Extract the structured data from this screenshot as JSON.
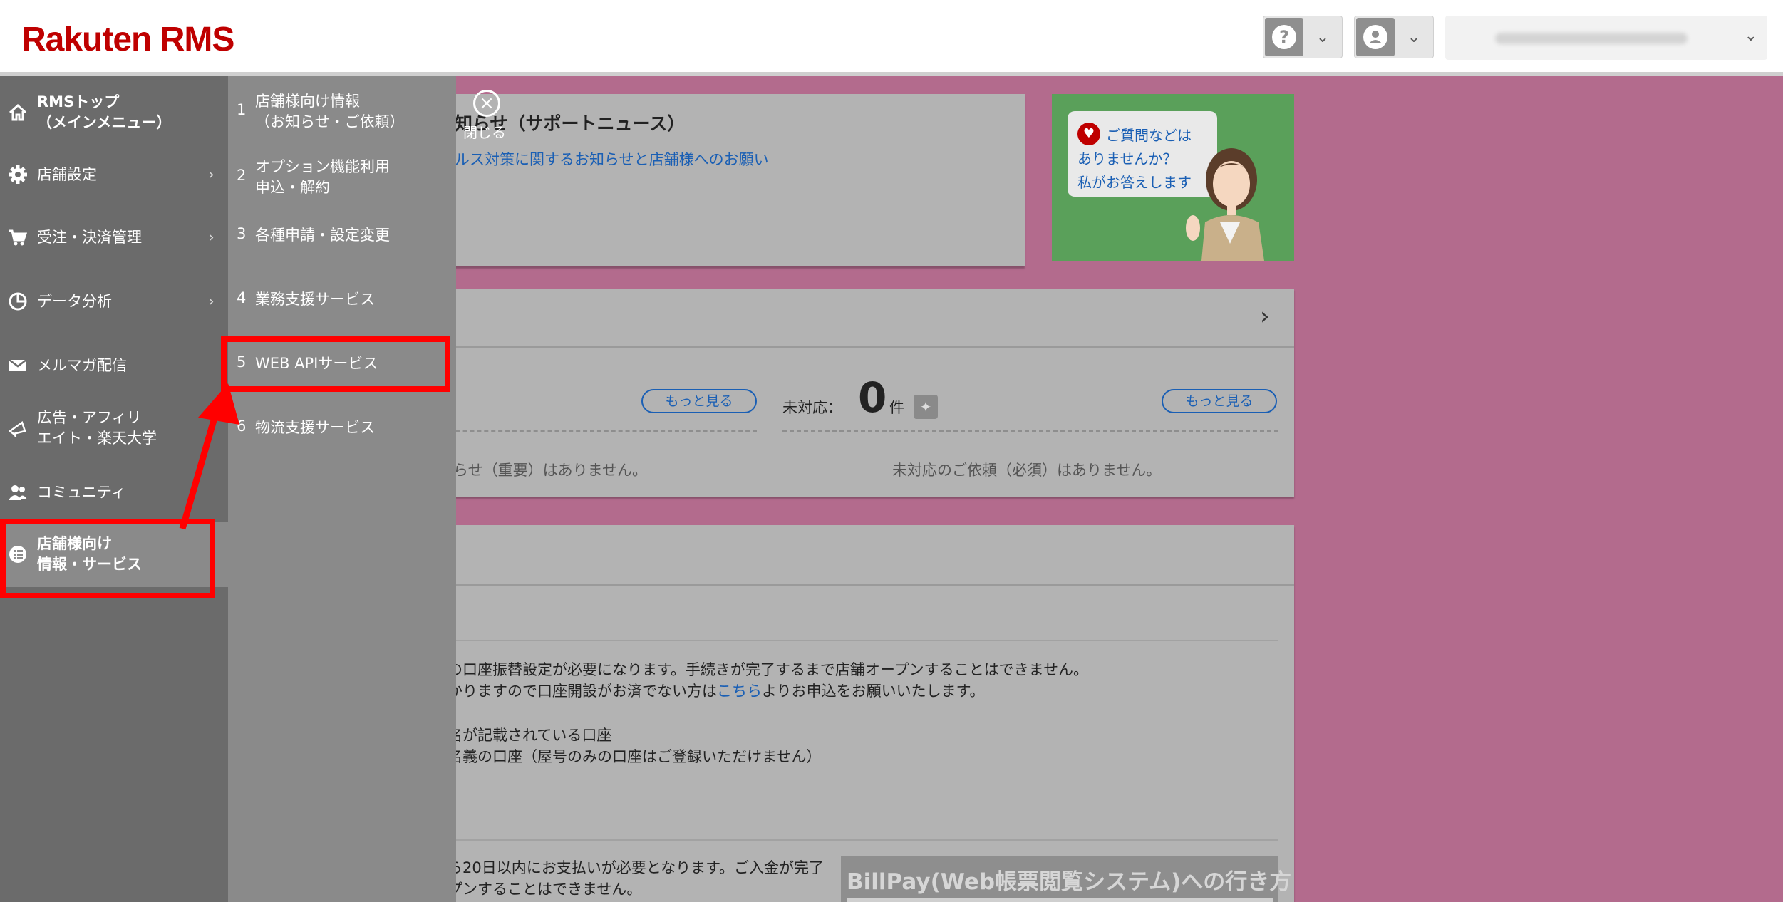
{
  "header": {
    "logo": "Rakuten RMS",
    "help_icon": "?",
    "chevron": "⌄"
  },
  "sidebar": {
    "items": [
      {
        "label": "RMSトップ\n（メインメニュー）",
        "icon": "home-icon"
      },
      {
        "label": "店舗設定",
        "icon": "gear-icon",
        "arrow": "›"
      },
      {
        "label": "受注・決済管理",
        "icon": "cart-icon",
        "arrow": "›"
      },
      {
        "label": "データ分析",
        "icon": "pie-chart-icon",
        "arrow": "›"
      },
      {
        "label": "メルマガ配信",
        "icon": "mail-icon"
      },
      {
        "label": "広告・アフィリ\nエイト・楽天大学",
        "icon": "megaphone-icon"
      },
      {
        "label": "コミュニティ",
        "icon": "users-icon"
      },
      {
        "label": "店舗様向け\n情報・サービス",
        "icon": "list-icon"
      }
    ]
  },
  "submenu": {
    "items": [
      {
        "num": "1",
        "label": "店舗様向け情報\n（お知らせ・ご依頼）"
      },
      {
        "num": "2",
        "label": "オプション機能利用\n申込・解約"
      },
      {
        "num": "3",
        "label": "各種申請・設定変更"
      },
      {
        "num": "4",
        "label": "業務支援サービス"
      },
      {
        "num": "5",
        "label": "WEB APIサービス"
      },
      {
        "num": "6",
        "label": "物流支援サービス"
      }
    ]
  },
  "main": {
    "news_title": "知らせ（サポートニュース）",
    "close_label": "閉じる",
    "news_link": "ルス対策に関するお知らせと店舗様へのお願い",
    "help_bubble": "ご質問などは\nありませんか？\n私がお答えします",
    "more_label": "もっと見る",
    "pending_label": "未対応：",
    "pending_count": "0",
    "pending_unit": "件",
    "no_notice": "らせ（重要）はありません。",
    "no_request": "未対応のご依頼（必須）はありません。",
    "body_line1": "の口座振替設定が必要になります。手続きが完了するまで店舗オープンすることはできません。",
    "body_line2a": "かりますので口座開設がお済でない方は",
    "body_link": "こちら",
    "body_line2b": "よりお申込をお願いいたします。",
    "body_line3": "名が記載されている口座",
    "body_line4": "名義の口座（屋号のみの口座はご登録いただけません）",
    "body_line5": "ら20日以内にお支払いが必要となります。ご入金が完了",
    "body_line6": "プンすることはできません。",
    "billpay_title": "BillPay(Web帳票閲覧システム)への行き方"
  }
}
